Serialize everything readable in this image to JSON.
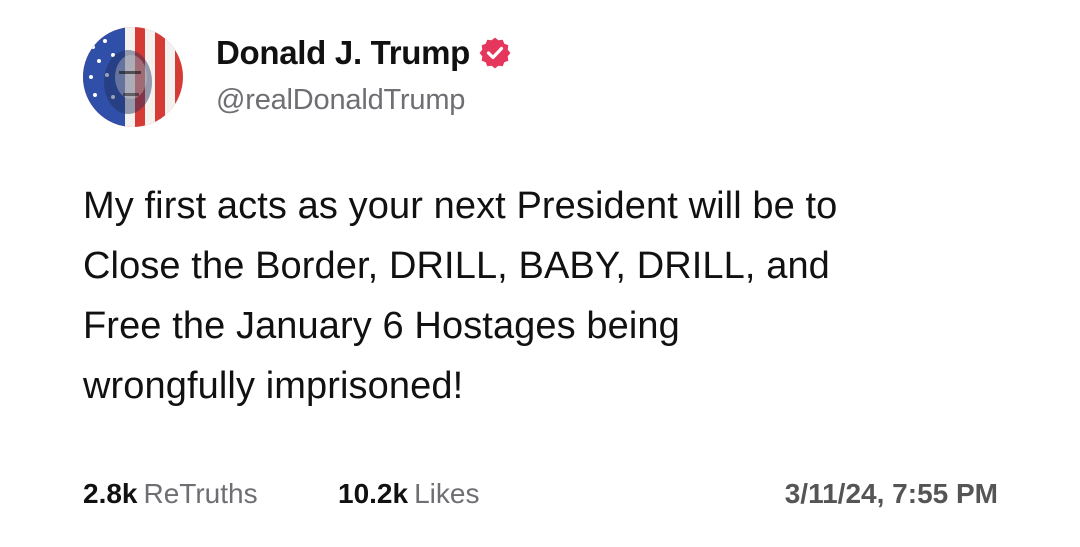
{
  "post": {
    "author": {
      "display_name": "Donald J. Trump",
      "handle": "@realDonaldTrump",
      "verified": true,
      "verified_badge_color": "#e5365b",
      "avatar_icon": "flag-portrait-avatar"
    },
    "text_lines": [
      "My first acts as your next President will be to",
      "Close the Border, DRILL, BABY, DRILL, and",
      "Free the January 6 Hostages being",
      "wrongfully imprisoned!"
    ],
    "stats": {
      "retruths_count": "2.8k",
      "retruths_label": "ReTruths",
      "likes_count": "10.2k",
      "likes_label": "Likes"
    },
    "timestamp": "3/11/24, 7:55 PM"
  },
  "colors": {
    "text": "#111111",
    "muted": "#6e6e73",
    "background": "#ffffff"
  }
}
